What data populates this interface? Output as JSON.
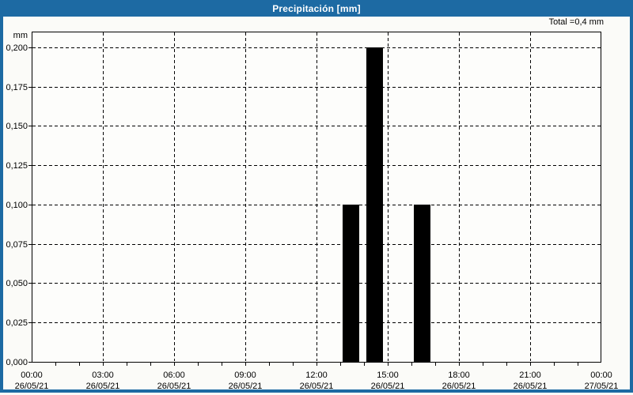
{
  "window": {
    "title": "Precipitación [mm]"
  },
  "header": {
    "total_label": "Total =0,4 mm"
  },
  "y_axis": {
    "unit_label": "mm"
  },
  "colors": {
    "titlebar_bg": "#1D6AA3",
    "titlebar_text": "#FFFFFF",
    "frame": "#1D6AA3",
    "window_bg": "#FBFBF8",
    "plot_bg": "#FDFDFB",
    "grid": "#000000",
    "axis": "#000000",
    "bar_fill": "#000000",
    "text": "#000000"
  },
  "chart_data": {
    "type": "bar",
    "title": "Precipitación [mm]",
    "ylabel": "mm",
    "xlabel": "",
    "total_label": "Total =0,4 mm",
    "total_value_mm": 0.4,
    "grid": "dashed",
    "legend": "none",
    "ylim": [
      0,
      0.21
    ],
    "x_range_hours": [
      0,
      24
    ],
    "minor_x_tick_every_hours": 1,
    "y_ticks": [
      {
        "value": 0.0,
        "label": "0,000"
      },
      {
        "value": 0.025,
        "label": "0,025"
      },
      {
        "value": 0.05,
        "label": "0,050"
      },
      {
        "value": 0.075,
        "label": "0,075"
      },
      {
        "value": 0.1,
        "label": "0,100"
      },
      {
        "value": 0.125,
        "label": "0,125"
      },
      {
        "value": 0.15,
        "label": "0,150"
      },
      {
        "value": 0.175,
        "label": "0,175"
      },
      {
        "value": 0.2,
        "label": "0,200"
      }
    ],
    "x_ticks": [
      {
        "hour": 0,
        "time": "00:00",
        "date": "26/05/21"
      },
      {
        "hour": 3,
        "time": "03:00",
        "date": "26/05/21"
      },
      {
        "hour": 6,
        "time": "06:00",
        "date": "26/05/21"
      },
      {
        "hour": 9,
        "time": "09:00",
        "date": "26/05/21"
      },
      {
        "hour": 12,
        "time": "12:00",
        "date": "26/05/21"
      },
      {
        "hour": 15,
        "time": "15:00",
        "date": "26/05/21"
      },
      {
        "hour": 18,
        "time": "18:00",
        "date": "26/05/21"
      },
      {
        "hour": 21,
        "time": "21:00",
        "date": "26/05/21"
      },
      {
        "hour": 24,
        "time": "00:00",
        "date": "27/05/21"
      }
    ],
    "series": [
      {
        "name": "Precipitación",
        "unit": "mm",
        "bars": [
          {
            "start_hour": 13,
            "end_hour": 14,
            "start": "13:00",
            "end": "14:00",
            "value": 0.1
          },
          {
            "start_hour": 14,
            "end_hour": 15,
            "start": "14:00",
            "end": "15:00",
            "value": 0.2
          },
          {
            "start_hour": 16,
            "end_hour": 17,
            "start": "16:00",
            "end": "17:00",
            "value": 0.1
          }
        ]
      }
    ]
  }
}
